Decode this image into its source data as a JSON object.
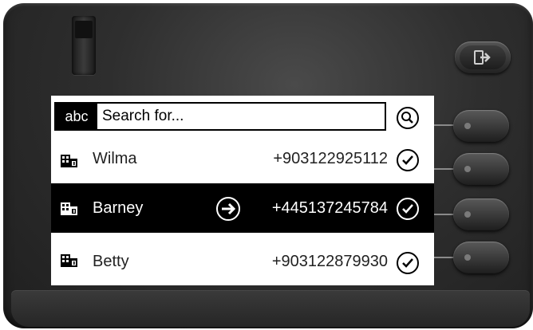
{
  "search": {
    "mode_label": "abc",
    "placeholder": "Search for..."
  },
  "contacts": [
    {
      "name": "Wilma",
      "number": "+903122925112",
      "selected": false
    },
    {
      "name": "Barney",
      "number": "+445137245784",
      "selected": true
    },
    {
      "name": "Betty",
      "number": "+903122879930",
      "selected": false
    }
  ],
  "icons": {
    "logout": "logout-icon",
    "search": "magnifier-icon",
    "select": "checkmark-icon",
    "navigate": "arrow-right-icon",
    "contact": "building-contact-icon"
  },
  "colors": {
    "selected_row": "#000000",
    "screen": "#ffffff"
  }
}
